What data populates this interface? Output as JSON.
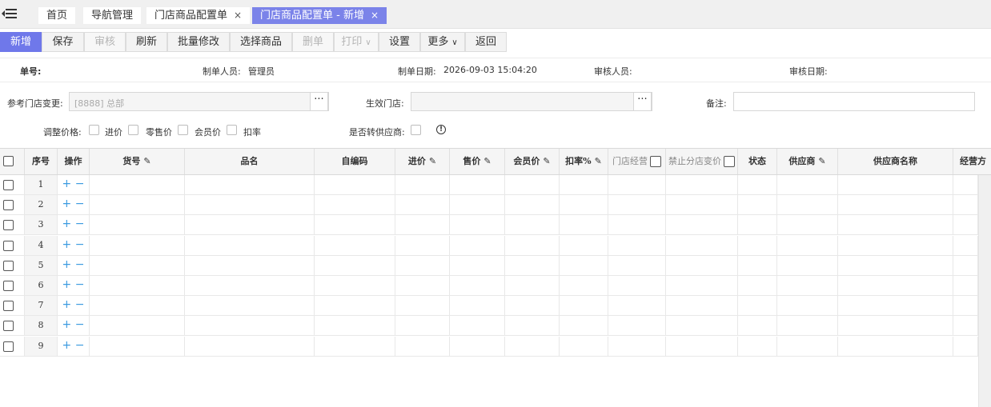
{
  "tabs": [
    {
      "label": "首页",
      "closable": false,
      "active": false
    },
    {
      "label": "导航管理",
      "closable": false,
      "active": false
    },
    {
      "label": "门店商品配置单",
      "closable": true,
      "active": false
    },
    {
      "label": "门店商品配置单 - 新增",
      "closable": true,
      "active": true
    }
  ],
  "close_glyph": "×",
  "toolbar": {
    "new": "新增",
    "save": "保存",
    "audit": "审核",
    "refresh": "刷新",
    "batch_edit": "批量修改",
    "select_goods": "选择商品",
    "delete": "删单",
    "print": "打印",
    "settings": "设置",
    "more": "更多",
    "back": "返回",
    "caret": "∨"
  },
  "header_info": {
    "doc_no_label": "单号:",
    "creator_label": "制单人员:",
    "creator_value": "管理员",
    "create_date_label": "制单日期:",
    "create_date_value": "2026-09-03 15:04:20",
    "auditor_label": "审核人员:",
    "audit_date_label": "审核日期:"
  },
  "form": {
    "ref_store_label": "参考门店变更:",
    "ref_store_value": "[8888]  总部",
    "effective_store_label": "生效门店:",
    "remark_label": "备注:",
    "dots": "···",
    "adjust_price_label": "调整价格:",
    "price_options": [
      "进价",
      "零售价",
      "会员价",
      "扣率"
    ],
    "to_supplier_label": "是否转供应商:",
    "info_glyph": "!"
  },
  "grid": {
    "columns": {
      "seq": "序号",
      "op": "操作",
      "item_no": "货号",
      "name": "品名",
      "self_code": "自编码",
      "cost_price": "进价",
      "sale_price": "售价",
      "member_price": "会员价",
      "discount": "扣率%",
      "store_manage": "门店经营",
      "forbid_change": "禁止分店变价",
      "status": "状态",
      "supplier": "供应商",
      "supplier_name": "供应商名称",
      "manage_mode": "经营方"
    },
    "edit_glyph": "✎",
    "add_glyph": "+",
    "remove_glyph": "−",
    "rows": [
      "1",
      "2",
      "3",
      "4",
      "5",
      "6",
      "7",
      "8",
      "9"
    ]
  }
}
